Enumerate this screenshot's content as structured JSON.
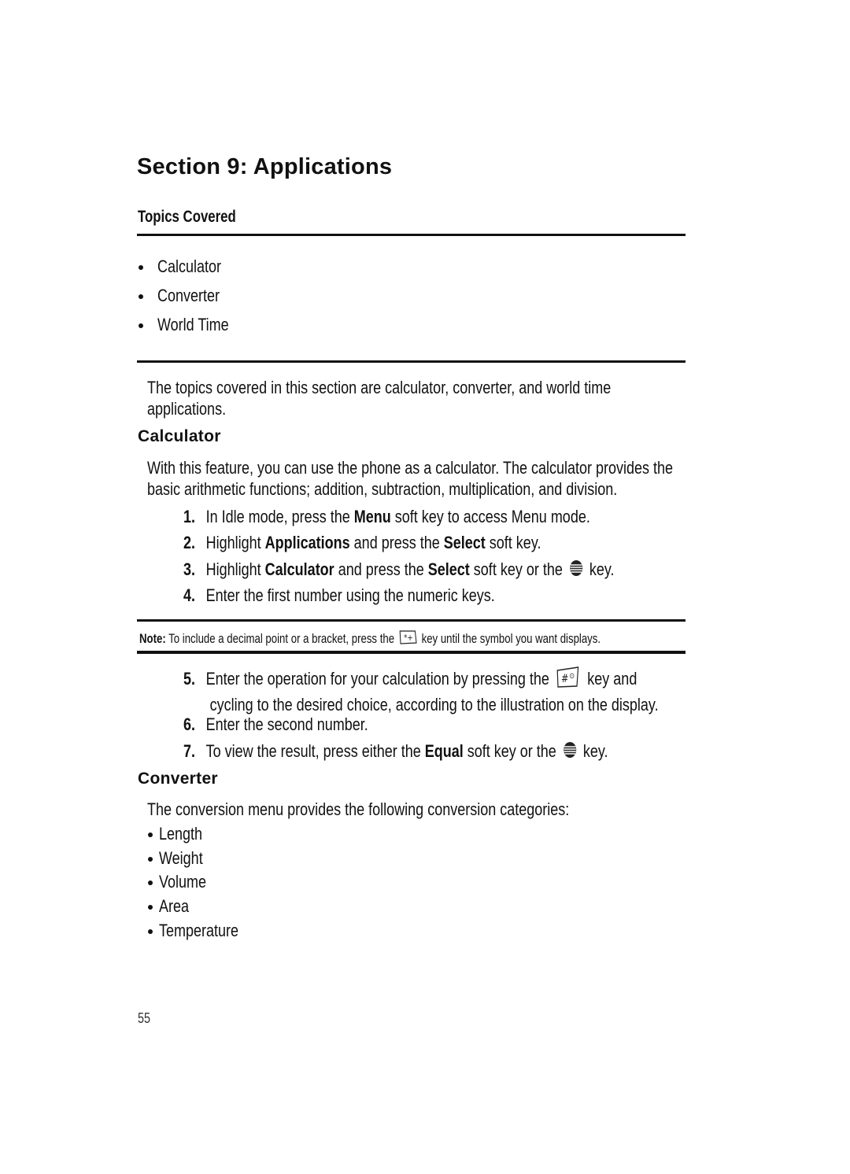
{
  "section_title": "Section 9: Applications",
  "topics_heading": "Topics Covered",
  "topics": [
    "Calculator",
    "Converter",
    "World Time"
  ],
  "intro": [
    "The topics covered in this section are calculator, converter, and world time",
    "applications."
  ],
  "calculator": {
    "heading": "Calculator",
    "paragraph": [
      "With this feature, you can use the phone as a calculator. The calculator provides the",
      "basic arithmetic functions; addition, subtraction, multiplication, and division."
    ],
    "steps": [
      {
        "num": "1.",
        "pre": "In Idle mode, press the ",
        "b1": "Menu",
        "mid": " soft key to access Menu mode."
      },
      {
        "num": "2.",
        "pre": "Highlight ",
        "b1": "Applications",
        "mid": " and press the ",
        "b2": "Select",
        "post": " soft key."
      },
      {
        "num": "3.",
        "pre": "Highlight ",
        "b1": "Calculator",
        "mid": " and press the ",
        "b2": "Select",
        "post": " soft key or the",
        "icon": "att-globe-key-icon",
        "end": " key."
      },
      {
        "num": "4.",
        "pre": "Enter the first number using the numeric keys."
      }
    ],
    "note": {
      "label": "Note:",
      "pre": " To include a decimal point or a bracket, press the",
      "icon": "star-key-icon",
      "post": " key until the symbol you want displays."
    },
    "steps2": [
      {
        "num": "5.",
        "line1_pre": "Enter the operation for your calculation by pressing the",
        "icon": "pound-key-icon",
        "line1_post": " key and",
        "line2": "cycling to the desired choice, according to the illustration on the display."
      },
      {
        "num": "6.",
        "pre": "Enter the second number."
      },
      {
        "num": "7.",
        "pre": "To view the result, press either the ",
        "b1": "Equal",
        "mid": " soft key or the",
        "icon": "att-globe-key-icon",
        "end": " key."
      }
    ]
  },
  "converter": {
    "heading": "Converter",
    "intro": "The conversion menu provides the following conversion categories:",
    "items": [
      "Length",
      "Weight",
      "Volume",
      "Area",
      "Temperature"
    ]
  },
  "page_number": "55"
}
